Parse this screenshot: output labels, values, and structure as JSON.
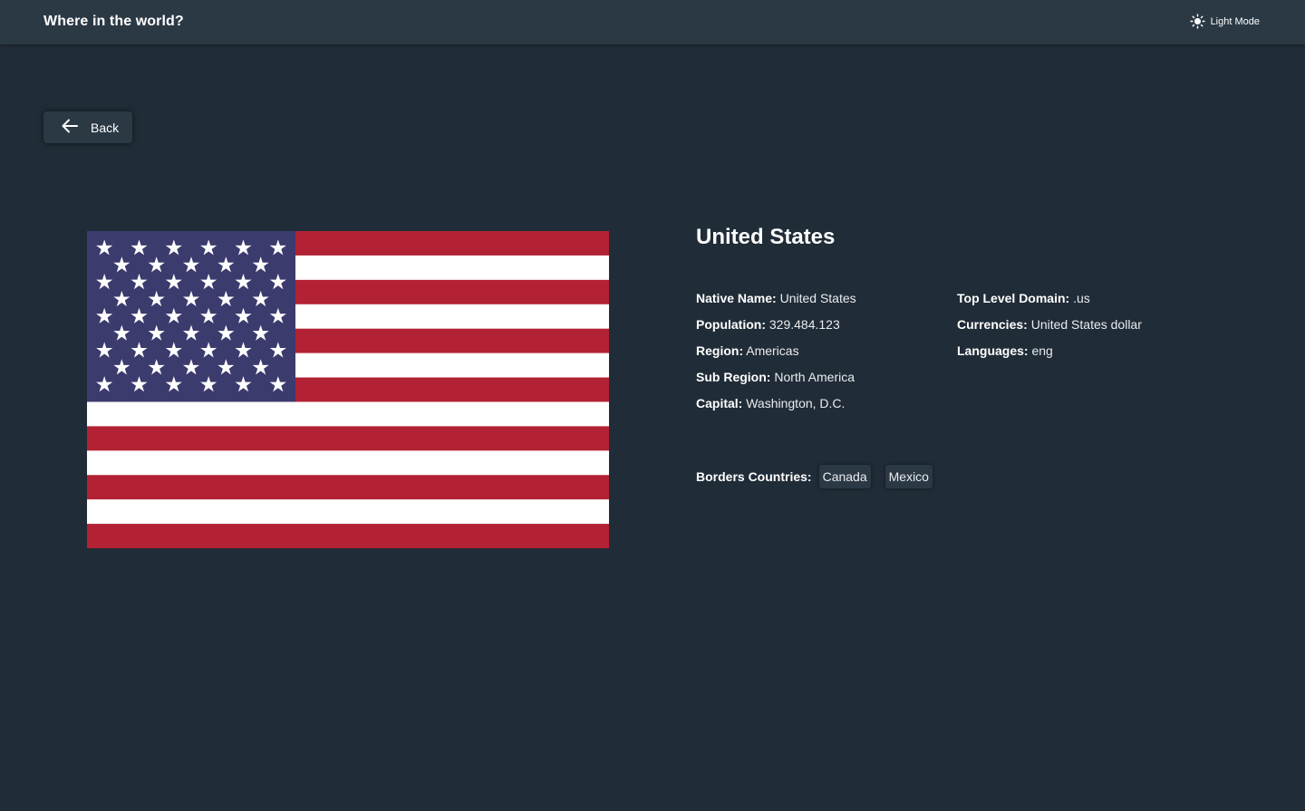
{
  "header": {
    "title": "Where in the world?",
    "theme_toggle_label": "Light Mode",
    "theme_icon": "sun-icon"
  },
  "back_button": {
    "label": "Back",
    "icon": "arrow-left-icon"
  },
  "country": {
    "name": "United States",
    "flag_icon": "us-flag",
    "details_left": [
      {
        "label": "Native Name:",
        "value": "United States"
      },
      {
        "label": "Population:",
        "value": "329.484.123"
      },
      {
        "label": "Region:",
        "value": "Americas"
      },
      {
        "label": "Sub Region:",
        "value": "North America"
      },
      {
        "label": "Capital:",
        "value": "Washington, D.C."
      }
    ],
    "details_right": [
      {
        "label": "Top Level Domain:",
        "value": ".us"
      },
      {
        "label": "Currencies:",
        "value": "United States dollar"
      },
      {
        "label": "Languages:",
        "value": "eng"
      }
    ],
    "borders_label": "Borders Countries:",
    "borders": [
      "Canada",
      "Mexico"
    ]
  },
  "colors": {
    "background": "#202c37",
    "element": "#2b3945",
    "flag_red": "#b22234",
    "flag_white": "#ffffff",
    "flag_blue": "#3c3b6e"
  }
}
